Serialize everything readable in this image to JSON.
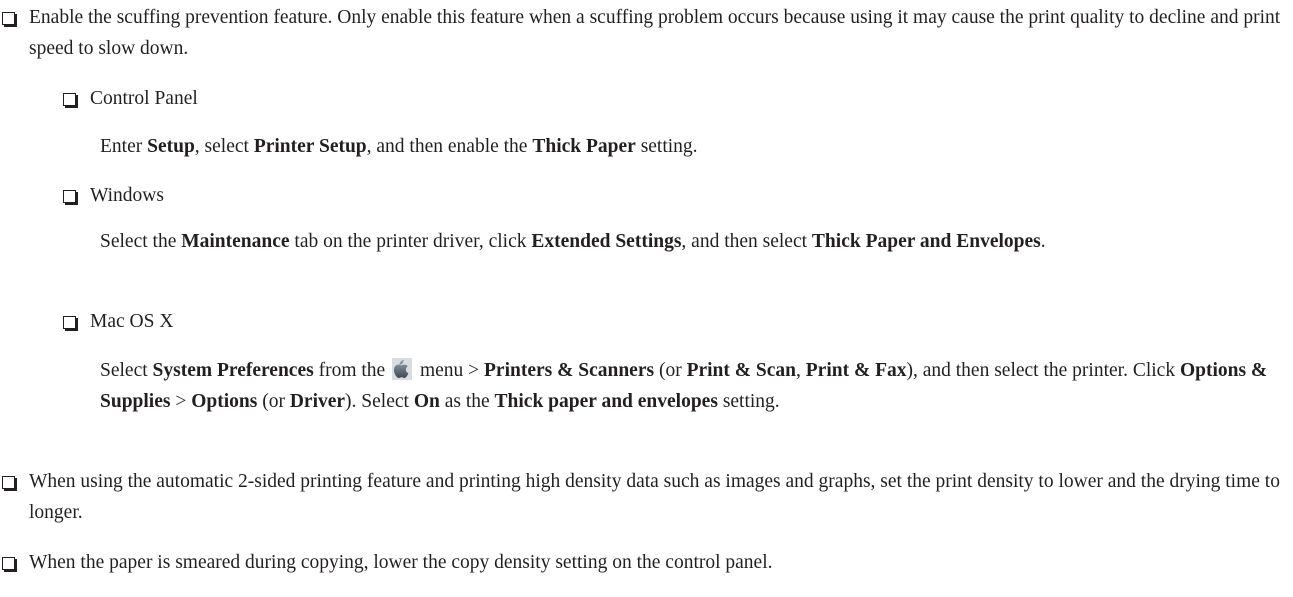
{
  "items": [
    {
      "text": "Enable the scuffing prevention feature. Only enable this feature when a scuffing problem occurs because using it may cause the print quality to decline and print speed to slow down."
    },
    {
      "text": "When using the automatic 2-sided printing feature and printing high density data such as images and graphs, set the print density to lower and the drying time to longer."
    },
    {
      "text": "When the paper is smeared during copying, lower the copy density setting on the control panel."
    }
  ],
  "subitems": {
    "control_panel": {
      "label": "Control Panel",
      "parts": [
        "Enter ",
        "Setup",
        ", select ",
        "Printer Setup",
        ", and then enable the ",
        "Thick Paper",
        " setting."
      ]
    },
    "windows": {
      "label": "Windows",
      "parts": [
        "Select the ",
        "Maintenance",
        " tab on the printer driver, click ",
        "Extended Settings",
        ", and then select ",
        "Thick Paper and Envelopes",
        "."
      ]
    },
    "mac": {
      "label": "Mac OS X",
      "parts": [
        "Select ",
        "System Preferences",
        " from the ",
        " menu > ",
        "Printers & Scanners",
        " (or ",
        "Print & Scan",
        ", ",
        "Print & Fax",
        "), and then select the printer. Click ",
        "Options & Supplies",
        " > ",
        "Options",
        " (or ",
        "Driver",
        "). Select ",
        "On",
        " as the ",
        "Thick paper and envelopes",
        " setting."
      ]
    }
  },
  "icons": {
    "checkbox": "checkbox-icon",
    "apple_menu": "apple-icon"
  },
  "colors": {
    "text": "#231f20"
  }
}
